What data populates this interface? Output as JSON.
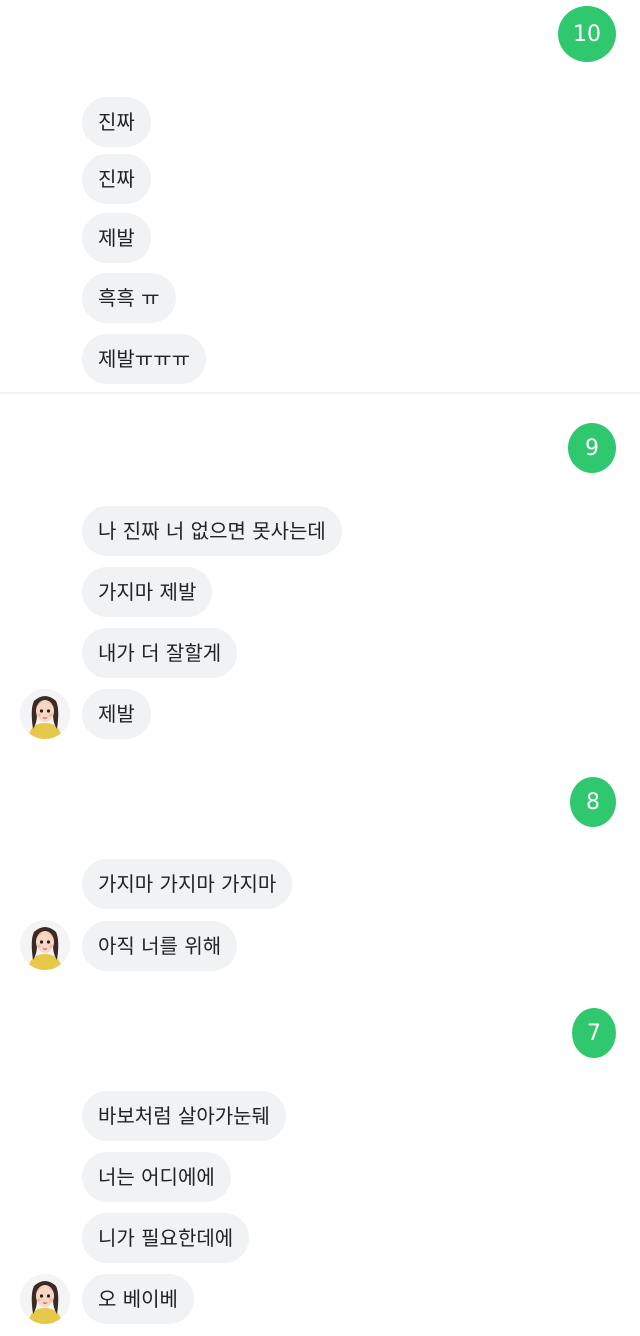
{
  "colors": {
    "sent_bubble": "#2fc86f",
    "received_bubble": "#f1f2f4",
    "text": "#222222"
  },
  "chat": {
    "sent": [
      "10",
      "9",
      "8",
      "7"
    ],
    "group1": [
      "진짜",
      "진짜",
      "제발",
      "흑흑 ㅠ",
      "제발ㅠㅠㅠ"
    ],
    "group2": [
      "나 진짜 너 없으면 못사는데",
      "가지마 제발",
      "내가 더 잘할게",
      "제발"
    ],
    "group3": [
      "가지마 가지마 가지마",
      "아직 너를 위해"
    ],
    "group4": [
      "바보처럼 살아가눈뒈",
      "너는 어디에에",
      "니가 필요한데에",
      "오 베이베"
    ],
    "avatar_icon": "girl-avatar-icon"
  }
}
